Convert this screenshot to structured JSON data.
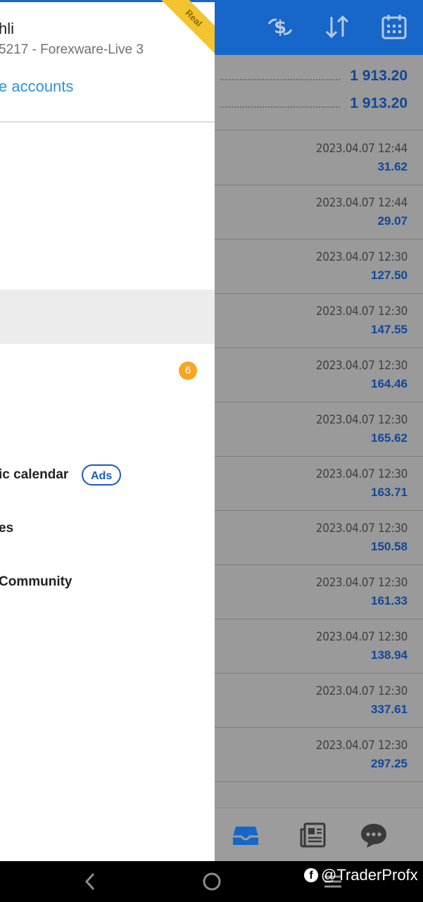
{
  "drawer": {
    "account_name": "hli",
    "account_number": "5217 - Forexware-Live 3",
    "manage_accounts": "e accounts",
    "ribbon": "Real",
    "badge_count": "6",
    "menu": {
      "calendar": "ic calendar",
      "ads": "Ads",
      "item_es": "es",
      "community": "Community"
    }
  },
  "topbar_icons": [
    "currency-exchange-icon",
    "sort-arrows-icon",
    "calendar-icon"
  ],
  "balance": {
    "line1": "1 913.20",
    "line2": "1 913.20"
  },
  "deals": [
    {
      "datetime": "2023.04.07 12:44",
      "amount": "31.62"
    },
    {
      "datetime": "2023.04.07 12:44",
      "amount": "29.07"
    },
    {
      "datetime": "2023.04.07 12:30",
      "amount": "127.50"
    },
    {
      "datetime": "2023.04.07 12:30",
      "amount": "147.55"
    },
    {
      "datetime": "2023.04.07 12:30",
      "amount": "164.46"
    },
    {
      "datetime": "2023.04.07 12:30",
      "amount": "165.62"
    },
    {
      "datetime": "2023.04.07 12:30",
      "amount": "163.71"
    },
    {
      "datetime": "2023.04.07 12:30",
      "amount": "150.58"
    },
    {
      "datetime": "2023.04.07 12:30",
      "amount": "161.33"
    },
    {
      "datetime": "2023.04.07 12:30",
      "amount": "138.94"
    },
    {
      "datetime": "2023.04.07 12:30",
      "amount": "337.61"
    },
    {
      "datetime": "2023.04.07 12:30",
      "amount": "297.25"
    }
  ],
  "bottom_nav_icons": [
    "inbox-icon",
    "news-icon",
    "chat-icon"
  ],
  "watermark": "@TraderProfx",
  "colors": {
    "accent": "#1766c9",
    "link": "#2a95d6",
    "badge": "#f5a623",
    "value": "#12479a"
  }
}
